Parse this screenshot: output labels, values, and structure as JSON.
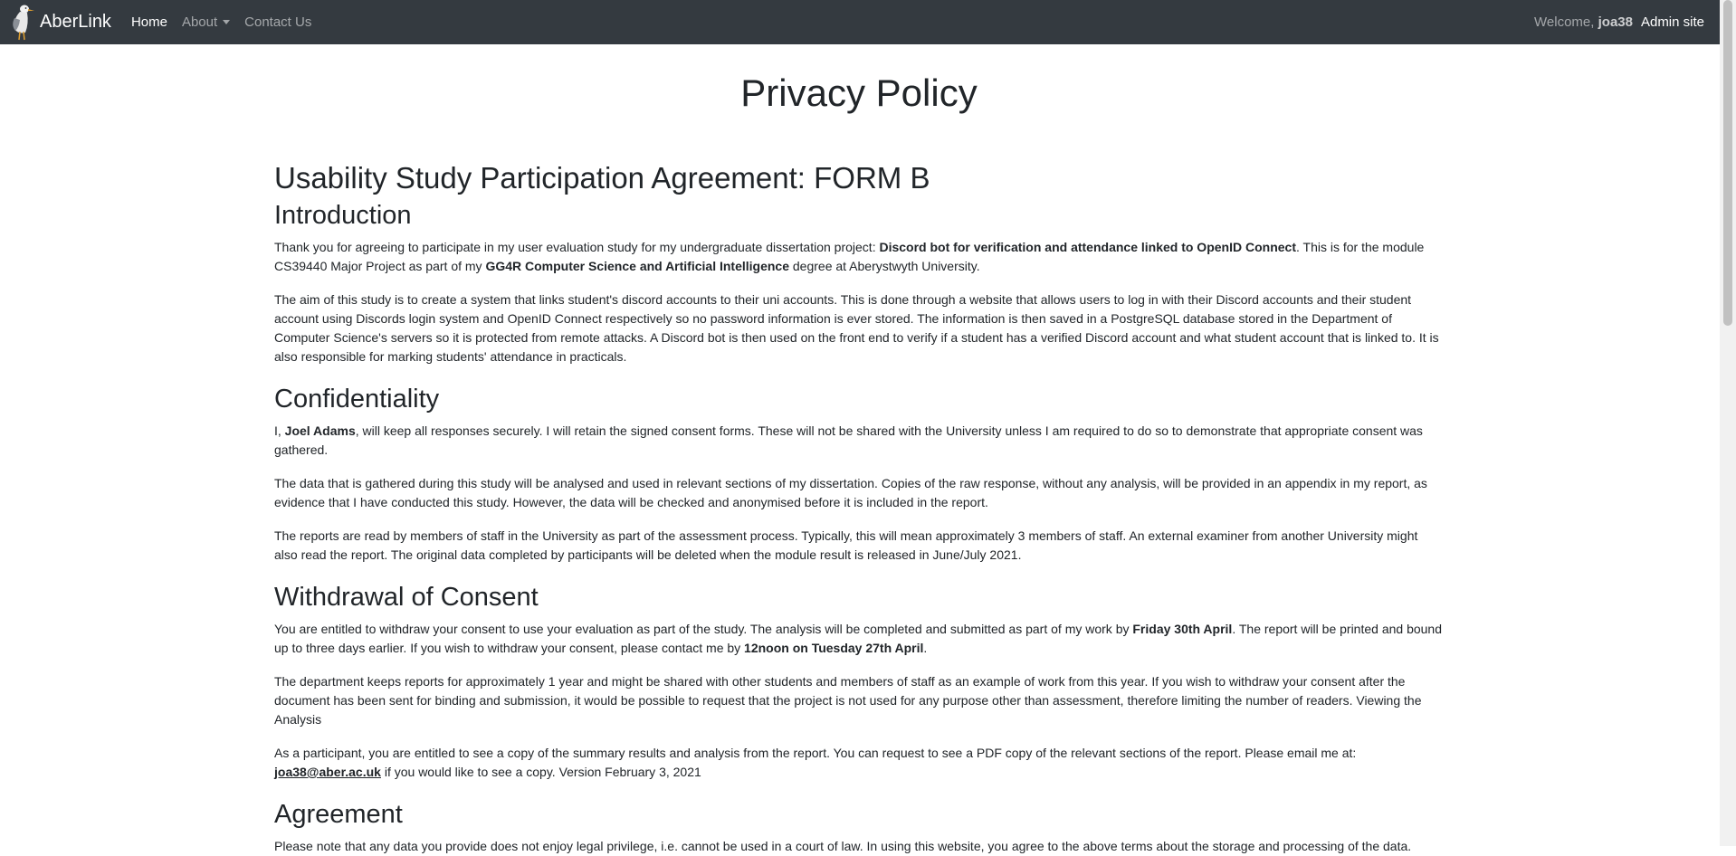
{
  "navbar": {
    "brand": "AberLink",
    "links": [
      {
        "label": "Home"
      },
      {
        "label": "About"
      },
      {
        "label": "Contact Us"
      }
    ],
    "welcome_prefix": "Welcome,",
    "username": "joa38",
    "admin_label": "Admin site"
  },
  "page": {
    "title": "Privacy Policy",
    "form_title": "Usability Study Participation Agreement: FORM B",
    "intro": {
      "heading": "Introduction",
      "p1": {
        "a": "Thank you for agreeing to participate in my user evaluation study for my undergraduate dissertation project: ",
        "b": "Discord bot for verification and attendance linked to OpenID Connect",
        "c": ". This is for the module CS39440 Major Project as part of my ",
        "d": "GG4R Computer Science and Artificial Intelligence",
        "e": " degree at Aberystwyth University."
      },
      "p2": "The aim of this study is to create a system that links student's discord accounts to their uni accounts. This is done through a website that allows users to log in with their Discord accounts and their student account using Discords login system and OpenID Connect respectively so no password information is ever stored. The information is then saved in a PostgreSQL database stored in the Department of Computer Science's servers so it is protected from remote attacks. A Discord bot is then used on the front end to verify if a student has a verified Discord account and what student account that is linked to. It is also responsible for marking students' attendance in practicals."
    },
    "confidentiality": {
      "heading": "Confidentiality",
      "p1": {
        "a": "I, ",
        "b": "Joel Adams",
        "c": ", will keep all responses securely. I will retain the signed consent forms. These will not be shared with the University unless I am required to do so to demonstrate that appropriate consent was gathered."
      },
      "p2": "The data that is gathered during this study will be analysed and used in relevant sections of my dissertation. Copies of the raw response, without any analysis, will be provided in an appendix in my report, as evidence that I have conducted this study. However, the data will be checked and anonymised before it is included in the report.",
      "p3": "The reports are read by members of staff in the University as part of the assessment process. Typically, this will mean approximately 3 members of staff. An external examiner from another University might also read the report. The original data completed by participants will be deleted when the module result is released in June/July 2021."
    },
    "withdrawal": {
      "heading": "Withdrawal of Consent",
      "p1": {
        "a": "You are entitled to withdraw your consent to use your evaluation as part of the study. The analysis will be completed and submitted as part of my work by ",
        "b": "Friday 30th April",
        "c": ". The report will be printed and bound up to three days earlier. If you wish to withdraw your consent, please contact me by ",
        "d": "12noon on Tuesday 27th April",
        "e": "."
      },
      "p2": "The department keeps reports for approximately 1 year and might be shared with other students and members of staff as an example of work from this year. If you wish to withdraw your consent after the document has been sent for binding and submission, it would be possible to request that the project is not used for any purpose other than assessment, therefore limiting the number of readers. Viewing the Analysis",
      "p3": {
        "a": "As a participant, you are entitled to see a copy of the summary results and analysis from the report. You can request to see a PDF copy of the relevant sections of the report. Please email me at: ",
        "email": "joa38@aber.ac.uk",
        "c": " if you would like to see a copy. Version February 3, 2021"
      }
    },
    "agreement": {
      "heading": "Agreement",
      "p1": "Please note that any data you provide does not enjoy legal privilege, i.e. cannot be used in a court of law. In using this website, you agree to the above terms about the storage and processing of the data."
    }
  }
}
